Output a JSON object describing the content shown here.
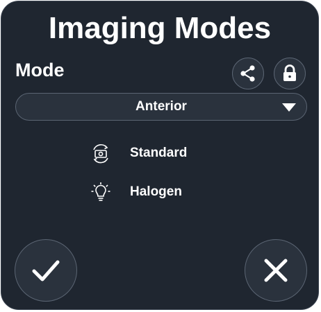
{
  "dialog": {
    "title": "Imaging Modes"
  },
  "mode": {
    "label": "Mode",
    "selected": "Anterior",
    "share_icon": "share-icon",
    "lock_icon": "lock-icon"
  },
  "info": [
    {
      "icon": "camera-rotate-icon",
      "label": "Standard"
    },
    {
      "icon": "lightbulb-icon",
      "label": "Halogen"
    }
  ],
  "actions": {
    "confirm_icon": "checkmark-icon",
    "cancel_icon": "close-icon"
  },
  "colors": {
    "background": "#1f2630",
    "button_fill": "#2a323d",
    "border": "#5b6573",
    "text": "#ffffff"
  }
}
